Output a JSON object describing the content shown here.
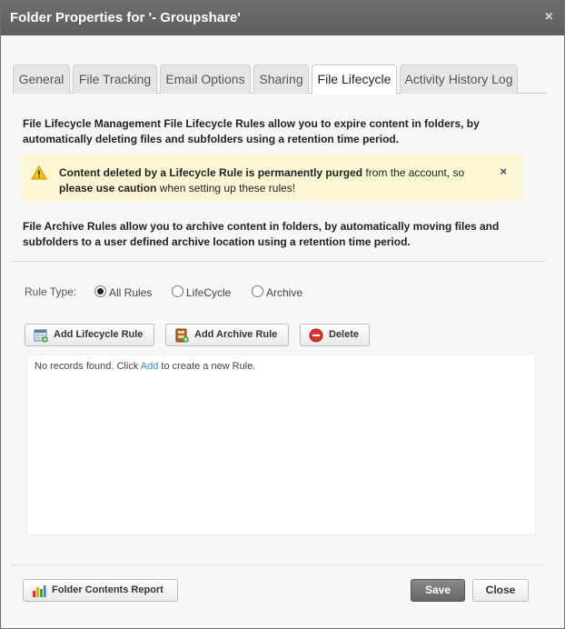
{
  "dialog": {
    "title": "Folder Properties for '- Groupshare'",
    "close_glyph": "×"
  },
  "tabs": [
    {
      "label": "General",
      "active": false
    },
    {
      "label": "File Tracking",
      "active": false
    },
    {
      "label": "Email Options",
      "active": false
    },
    {
      "label": "Sharing",
      "active": false
    },
    {
      "label": "File Lifecycle",
      "active": true
    },
    {
      "label": "Activity History Log",
      "active": false
    }
  ],
  "intro": {
    "line1": "File Lifecycle Management File Lifecycle Rules allow you to expire content in folders, by",
    "line2": "automatically deleting files and subfolders using a retention time period."
  },
  "warning": {
    "icon": "warning-icon",
    "bold1": "Content deleted by a Lifecycle Rule is permanently purged",
    "text1": " from the account, so",
    "bold2": "please use caution",
    "text2": " when setting up these rules!",
    "close_glyph": "×",
    "bg_color": "#fdf6d5"
  },
  "archive_intro": {
    "line1": "File Archive Rules allow you to archive content in folders, by automatically moving files and",
    "line2": "subfolders to a user defined archive location using a retention time period."
  },
  "rule_type": {
    "label": "Rule Type:",
    "options": [
      {
        "label": "All Rules",
        "checked": true
      },
      {
        "label": "LifeCycle",
        "checked": false
      },
      {
        "label": "Archive",
        "checked": false
      }
    ]
  },
  "toolbar": {
    "add_lifecycle": "Add Lifecycle Rule",
    "add_archive": "Add Archive Rule",
    "delete": "Delete"
  },
  "grid": {
    "empty_prefix": "No records found. Click ",
    "empty_link": "Add",
    "empty_suffix": " to create a new Rule."
  },
  "footer": {
    "report": "Folder Contents Report",
    "save": "Save",
    "close": "Close"
  },
  "colors": {
    "titlebar": "#666666",
    "link": "#3a8bd0",
    "save_button": "#777777"
  }
}
